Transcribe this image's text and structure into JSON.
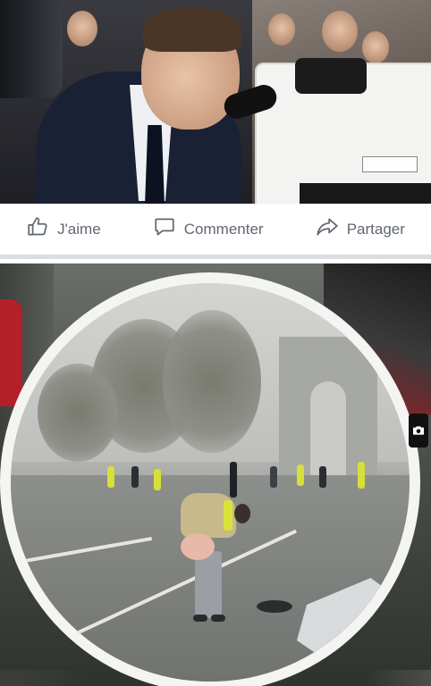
{
  "post1": {
    "actions": {
      "like_label": "J'aime",
      "comment_label": "Commenter",
      "share_label": "Partager"
    },
    "icons": {
      "like": "thumbs-up-icon",
      "comment": "comment-bubble-icon",
      "share": "share-arrow-icon"
    }
  },
  "post2": {
    "icons": {
      "camera": "camera-icon"
    }
  },
  "colors": {
    "action_text": "#606770",
    "divider": "#dadde1",
    "background": "#ffffff"
  }
}
